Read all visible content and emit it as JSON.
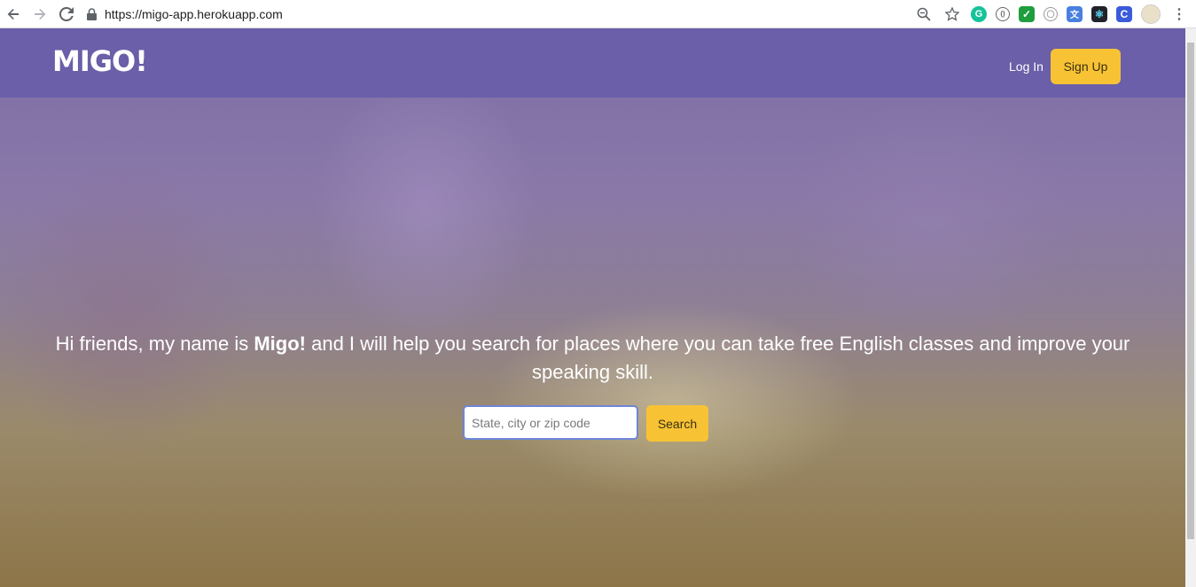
{
  "browser": {
    "url": "https://migo-app.herokuapp.com",
    "back_icon": "arrow-left-icon",
    "forward_icon": "arrow-right-icon",
    "reload_icon": "reload-icon",
    "extensions": [
      "zoom-icon",
      "star-icon",
      "grammarly-icon",
      "extension-icon",
      "checkmark-extension-icon",
      "github-icon",
      "translate-icon",
      "react-devtools-icon",
      "c-extension-icon",
      "profile-avatar-icon",
      "menu-icon"
    ]
  },
  "navbar": {
    "logo": "MIGO!",
    "login_label": "Log In",
    "signup_label": "Sign Up"
  },
  "hero": {
    "text_before": "Hi friends, my name is ",
    "text_bold": "Migo!",
    "text_after": " and I will help you search for places where you can take free English classes and improve your speaking skill."
  },
  "search": {
    "placeholder": "State, city or zip code",
    "button_label": "Search"
  },
  "colors": {
    "navbar": "#6a5fa8",
    "accent": "#f7c335"
  }
}
